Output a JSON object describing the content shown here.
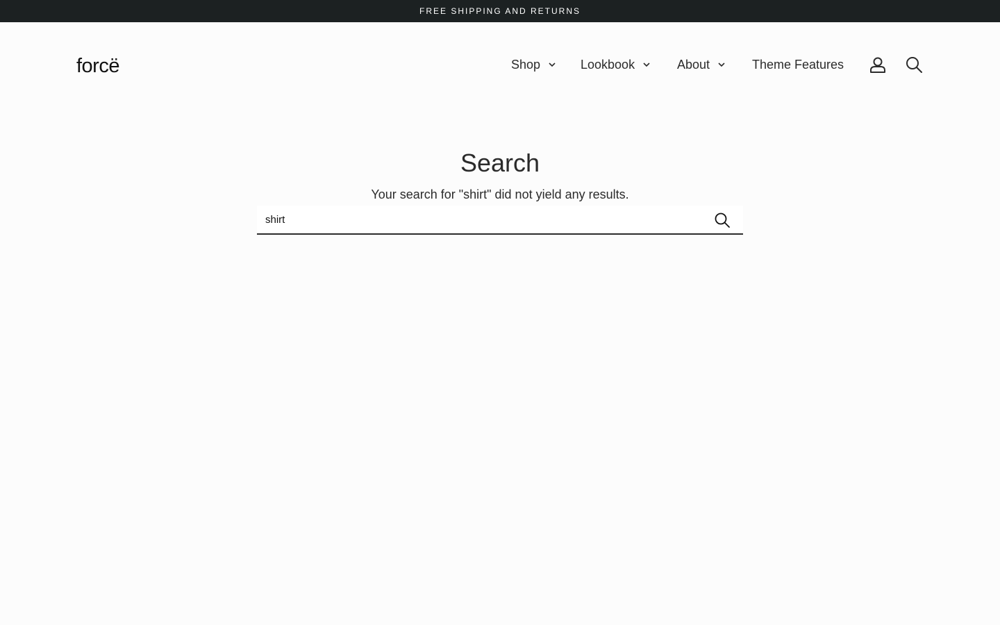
{
  "announcement": {
    "text": "FREE SHIPPING AND RETURNS"
  },
  "header": {
    "logo": "forcë",
    "nav": [
      {
        "label": "Shop",
        "has_dropdown": true
      },
      {
        "label": "Lookbook",
        "has_dropdown": true
      },
      {
        "label": "About",
        "has_dropdown": true
      },
      {
        "label": "Theme Features",
        "has_dropdown": false
      }
    ],
    "icons": {
      "account": "user-icon",
      "search": "search-icon"
    }
  },
  "main": {
    "title": "Search",
    "message": "Your search for \"shirt\" did not yield any results.",
    "search": {
      "value": "shirt",
      "submit_icon": "search-icon"
    }
  },
  "colors": {
    "announcement_bg": "#1c2122",
    "page_bg": "#fcfcfc",
    "text": "#2b2b2b"
  }
}
